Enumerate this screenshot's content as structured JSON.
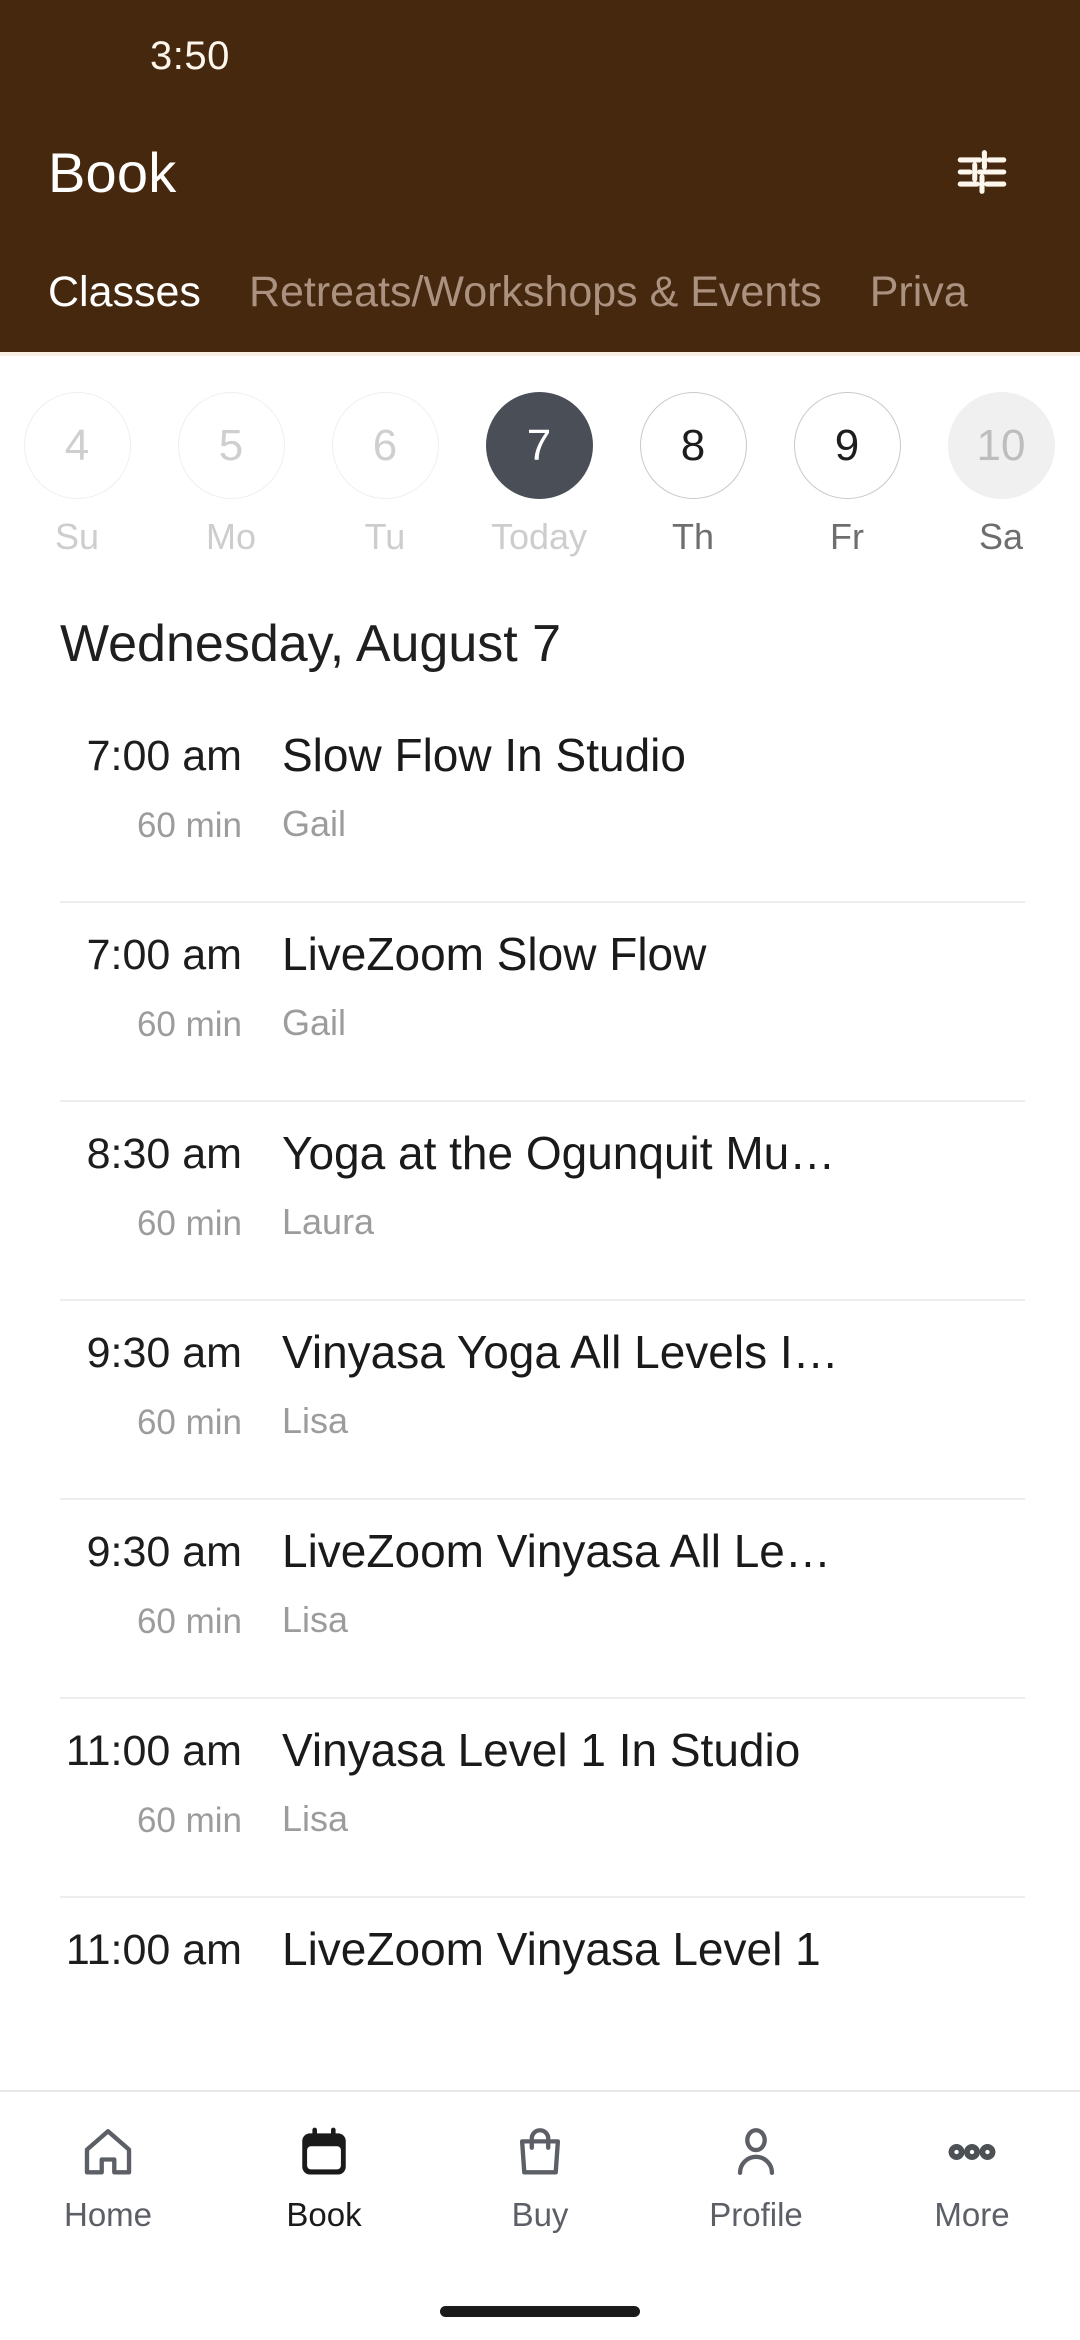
{
  "status_bar": {
    "time": "3:50"
  },
  "header": {
    "title": "Book",
    "filter_icon": "tune-icon",
    "background_color": "#46280f",
    "tabs": [
      {
        "label": "Classes",
        "active": true
      },
      {
        "label": "Retreats/Workshops & Events",
        "active": false
      },
      {
        "label": "Priva",
        "active": false
      }
    ]
  },
  "date_strip": {
    "days": [
      {
        "num": "4",
        "label": "Su",
        "state": "past"
      },
      {
        "num": "5",
        "label": "Mo",
        "state": "past"
      },
      {
        "num": "6",
        "label": "Tu",
        "state": "past"
      },
      {
        "num": "7",
        "label": "Today",
        "state": "today"
      },
      {
        "num": "8",
        "label": "Th",
        "state": "future"
      },
      {
        "num": "9",
        "label": "Fr",
        "state": "future"
      },
      {
        "num": "10",
        "label": "Sa",
        "state": "disabled"
      }
    ],
    "selected_color": "#4a4f57"
  },
  "day_title": "Wednesday, August 7",
  "classes": [
    {
      "time": "7:00 am",
      "duration": "60 min",
      "name": "Slow Flow In Studio",
      "instructor": "Gail"
    },
    {
      "time": "7:00 am",
      "duration": "60 min",
      "name": "LiveZoom Slow Flow",
      "instructor": "Gail"
    },
    {
      "time": "8:30 am",
      "duration": "60 min",
      "name": "Yoga at the Ogunquit Mu…",
      "instructor": "Laura"
    },
    {
      "time": "9:30 am",
      "duration": "60 min",
      "name": "Vinyasa Yoga All Levels I…",
      "instructor": "Lisa"
    },
    {
      "time": "9:30 am",
      "duration": "60 min",
      "name": "LiveZoom Vinyasa All Le…",
      "instructor": "Lisa"
    },
    {
      "time": "11:00 am",
      "duration": "60 min",
      "name": "Vinyasa Level 1 In Studio",
      "instructor": "Lisa"
    },
    {
      "time": "11:00 am",
      "duration": "",
      "name": "LiveZoom Vinyasa Level 1",
      "instructor": ""
    }
  ],
  "bottom_nav": {
    "items": [
      {
        "label": "Home",
        "icon": "house-icon",
        "active": false
      },
      {
        "label": "Book",
        "icon": "calendar-icon",
        "active": true
      },
      {
        "label": "Buy",
        "icon": "bag-icon",
        "active": false
      },
      {
        "label": "Profile",
        "icon": "person-icon",
        "active": false
      },
      {
        "label": "More",
        "icon": "dots-icon",
        "active": false
      }
    ]
  }
}
